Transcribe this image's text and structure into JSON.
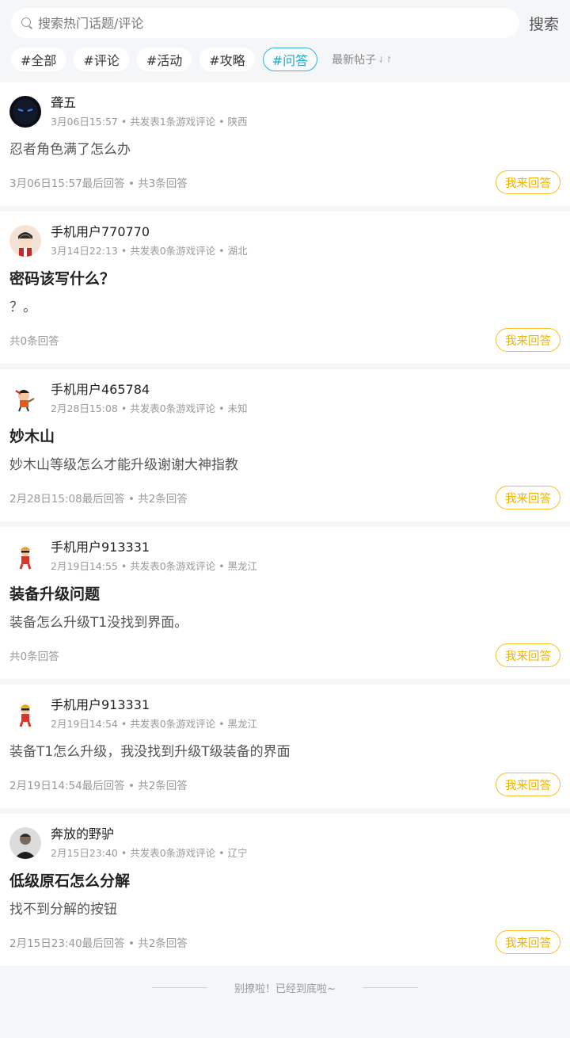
{
  "search": {
    "placeholder": "搜索热门话题/评论",
    "button": "搜索"
  },
  "tabs": [
    {
      "label": "#全部"
    },
    {
      "label": "#评论"
    },
    {
      "label": "#活动"
    },
    {
      "label": "#攻略"
    },
    {
      "label": "#问答"
    }
  ],
  "sort": {
    "label": "最新帖子",
    "icon": "sort-icon"
  },
  "posts": [
    {
      "author": "聋五",
      "meta": "3月06日15:57 • 共发表1条游戏评论 • 陕西",
      "title": "",
      "body": "忍者角色满了怎么办",
      "footer": "3月06日15:57最后回答 • 共3条回答",
      "reply": "我来回答"
    },
    {
      "author": "手机用户770770",
      "meta": "3月14日22:13 • 共发表0条游戏评论 • 湖北",
      "title": "密码该写什么？",
      "body": "？。",
      "footer": "共0条回答",
      "reply": "我来回答"
    },
    {
      "author": "手机用户465784",
      "meta": "2月28日15:08 • 共发表0条游戏评论 • 未知",
      "title": "妙木山",
      "body": "妙木山等级怎么才能升级谢谢大神指教",
      "footer": "2月28日15:08最后回答 • 共2条回答",
      "reply": "我来回答"
    },
    {
      "author": "手机用户913331",
      "meta": "2月19日14:55 • 共发表0条游戏评论 • 黑龙江",
      "title": "装备升级问题",
      "body": "装备怎么升级T1没找到界面。",
      "footer": "共0条回答",
      "reply": "我来回答"
    },
    {
      "author": "手机用户913331",
      "meta": "2月19日14:54 • 共发表0条游戏评论 • 黑龙江",
      "title": "",
      "body": "装备T1怎么升级，我没找到升级T级装备的界面",
      "footer": "2月19日14:54最后回答 • 共2条回答",
      "reply": "我来回答"
    },
    {
      "author": "奔放的野驴",
      "meta": "2月15日23:40 • 共发表0条游戏评论 • 辽宁",
      "title": "低级原石怎么分解",
      "body": "找不到分解的按钮",
      "footer": "2月15日23:40最后回答 • 共2条回答",
      "reply": "我来回答"
    }
  ],
  "end_text": "别撩啦！已经到底啦~",
  "colors": {
    "accent_tab": "#27a5c4",
    "reply_button": "#f1b400",
    "background": "#f5f6f8"
  }
}
